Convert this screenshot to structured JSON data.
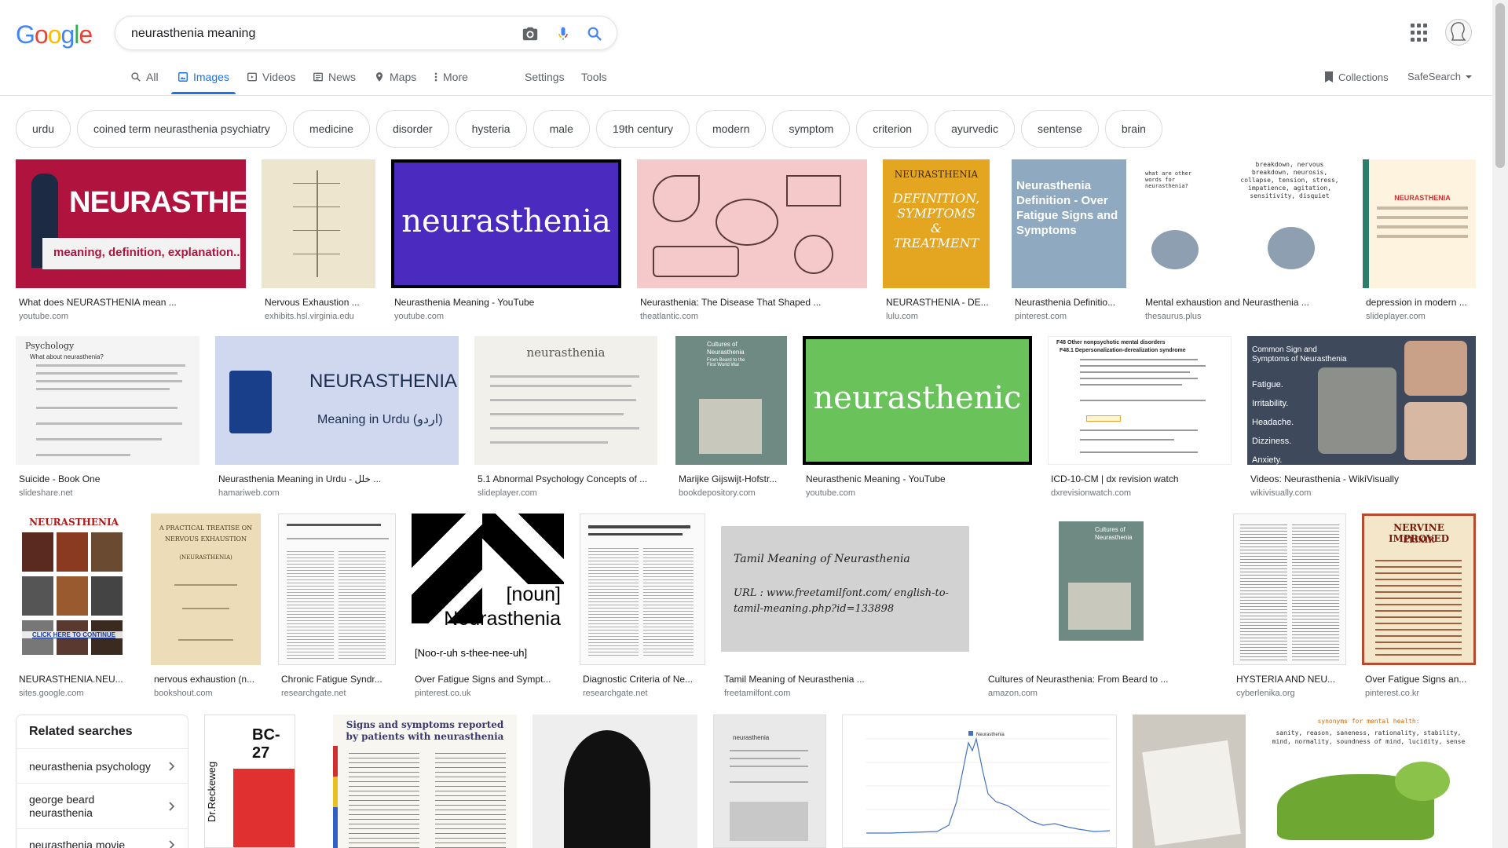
{
  "header": {
    "logo_letters": [
      "G",
      "o",
      "o",
      "g",
      "l",
      "e"
    ],
    "logo_colors": [
      "#4285F4",
      "#EA4335",
      "#FBBC05",
      "#4285F4",
      "#34A853",
      "#EA4335"
    ],
    "search_value": "neurasthenia meaning"
  },
  "tabs": [
    {
      "label": "All",
      "icon": "search-icon"
    },
    {
      "label": "Images",
      "icon": "image-icon",
      "active": true
    },
    {
      "label": "Videos",
      "icon": "video-icon"
    },
    {
      "label": "News",
      "icon": "news-icon"
    },
    {
      "label": "Maps",
      "icon": "map-icon"
    },
    {
      "label": "More",
      "icon": "more-vert-icon"
    },
    {
      "label": "Settings"
    },
    {
      "label": "Tools"
    }
  ],
  "collections_label": "Collections",
  "safesearch_label": "SafeSearch",
  "chips": [
    "urdu",
    "coined term neurasthenia psychiatry",
    "medicine",
    "disorder",
    "hysteria",
    "male",
    "19th century",
    "modern",
    "symptom",
    "criterion",
    "ayurvedic",
    "sentense",
    "brain"
  ],
  "rows": [
    [
      {
        "caption": "What does NEURASTHENIA mean ...",
        "source": "youtube.com",
        "thumb_text": "NEURASTHENIA",
        "thumb_sub": "meaning, definition, explanation..."
      },
      {
        "caption": "Nervous Exhaustion ...",
        "source": "exhibits.hsl.virginia.edu",
        "thumb_text": "",
        "thumb_sub": ""
      },
      {
        "caption": "Neurasthenia Meaning - YouTube",
        "source": "youtube.com",
        "thumb_text": "neurasthenia",
        "thumb_sub": ""
      },
      {
        "caption": "Neurasthenia: The Disease That Shaped ...",
        "source": "theatlantic.com",
        "thumb_text": "",
        "thumb_sub": ""
      },
      {
        "caption": "NEURASTHENIA - DE...",
        "source": "lulu.com",
        "thumb_text": "NEURASTHENIA",
        "thumb_sub": "DEFINITION, SYMPTOMS & TREATMENT"
      },
      {
        "caption": "Neurasthenia Definitio...",
        "source": "pinterest.com",
        "thumb_text": "Neurasthenia Definition - Over Fatigue Signs and Symptoms",
        "thumb_sub": ""
      },
      {
        "caption": "Mental exhaustion and Neurasthenia ...",
        "source": "thesaurus.plus",
        "thumb_text": "what are other words for neurasthenia?",
        "thumb_sub": "breakdown, nervous breakdown, neurosis, collapse, tension, stress, impatience, agitation, sensitivity, disquiet"
      },
      {
        "caption": "depression in modern ...",
        "source": "slideplayer.com",
        "thumb_text": "NEURASTHENIA",
        "thumb_sub": ""
      }
    ],
    [
      {
        "caption": "Suicide - Book One",
        "source": "slideshare.net",
        "thumb_text": "Psychology",
        "thumb_sub": "What about neurasthenia?"
      },
      {
        "caption": "Neurasthenia Meaning in Urdu - خلل ...",
        "source": "hamariweb.com",
        "thumb_text": "NEURASTHENIA",
        "thumb_sub": "Meaning in Urdu (اردو)"
      },
      {
        "caption": "5.1 Abnormal Psychology Concepts of ...",
        "source": "slideplayer.com",
        "thumb_text": "neurasthenia",
        "thumb_sub": ""
      },
      {
        "caption": "Marijke Gijswijt-Hofstr...",
        "source": "bookdepository.com",
        "thumb_text": "Cultures of Neurasthenia",
        "thumb_sub": "From Beard to the First World War"
      },
      {
        "caption": "Neurasthenic Meaning - YouTube",
        "source": "youtube.com",
        "thumb_text": "neurasthenic",
        "thumb_sub": ""
      },
      {
        "caption": "ICD-10-CM | dx revision watch",
        "source": "dxrevisionwatch.com",
        "thumb_text": "F48 Other nonpsychotic mental disorders",
        "thumb_sub": "F48.1 Depersonalization-derealization syndrome"
      },
      {
        "caption": "Videos: Neurasthenia - WikiVisually",
        "source": "wikivisually.com",
        "thumb_text": "Common Sign and Symptoms of Neurasthenia",
        "thumb_sub": "Fatigue. Irritability. Headache. Dizziness. Anxiety."
      }
    ],
    [
      {
        "caption": "NEURASTHENIA.NEU...",
        "source": "sites.google.com",
        "thumb_text": "NEURASTHENIA",
        "thumb_sub": "CLICK HERE TO CONTINUE"
      },
      {
        "caption": "nervous exhaustion (n...",
        "source": "bookshout.com",
        "thumb_text": "A PRACTICAL TREATISE ON NERVOUS EXHAUSTION",
        "thumb_sub": "(NEURASTHENIA)"
      },
      {
        "caption": "Chronic Fatigue Syndr...",
        "source": "researchgate.net",
        "thumb_text": "",
        "thumb_sub": ""
      },
      {
        "caption": "Over Fatigue Signs and Sympt...",
        "source": "pinterest.co.uk",
        "thumb_text": "[noun] Neurasthenia",
        "thumb_sub": "[Noo-r-uh s-thee-nee-uh]"
      },
      {
        "caption": "Diagnostic Criteria of Ne...",
        "source": "researchgate.net",
        "thumb_text": "",
        "thumb_sub": ""
      },
      {
        "caption": "Tamil Meaning of Neurasthenia ...",
        "source": "freetamilfont.com",
        "thumb_text": "Tamil Meaning of Neurasthenia",
        "thumb_sub": "URL : www.freetamilfont.com/ english-to-tamil-meaning.php?id=133898"
      },
      {
        "caption": "Cultures of Neurasthenia: From Beard to ...",
        "source": "amazon.com",
        "thumb_text": "Cultures of Neurasthenia",
        "thumb_sub": ""
      },
      {
        "caption": "HYSTERIA AND NEU...",
        "source": "cyberlenika.org",
        "thumb_text": "",
        "thumb_sub": ""
      },
      {
        "caption": "Over Fatigue Signs an...",
        "source": "pinterest.co.kr",
        "thumb_text": "NERVINE IMPROVED",
        "thumb_sub": "ELIXIR"
      }
    ],
    [
      {
        "caption": "",
        "source": "",
        "thumb_text": "BC-27",
        "thumb_sub": "Dr.Reckeweg"
      },
      {
        "caption": "",
        "source": "",
        "thumb_text": "Signs and symptoms reported by patients with neurasthenia",
        "thumb_sub": ""
      },
      {
        "caption": "",
        "source": "",
        "thumb_text": "",
        "thumb_sub": ""
      },
      {
        "caption": "",
        "source": "",
        "thumb_text": "neurasthenia",
        "thumb_sub": ""
      },
      {
        "caption": "",
        "source": "",
        "thumb_text": "Neurasthenia",
        "thumb_sub": ""
      },
      {
        "caption": "",
        "source": "",
        "thumb_text": "",
        "thumb_sub": ""
      },
      {
        "caption": "",
        "source": "",
        "thumb_text": "synonyms for mental health:",
        "thumb_sub": "sanity, reason, saneness, rationality, stability, mind, normality, soundness of mind, lucidity, sense"
      }
    ]
  ],
  "related": {
    "title": "Related searches",
    "items": [
      "neurasthenia psychology",
      "george beard neurasthenia",
      "neurasthenia movie"
    ]
  }
}
